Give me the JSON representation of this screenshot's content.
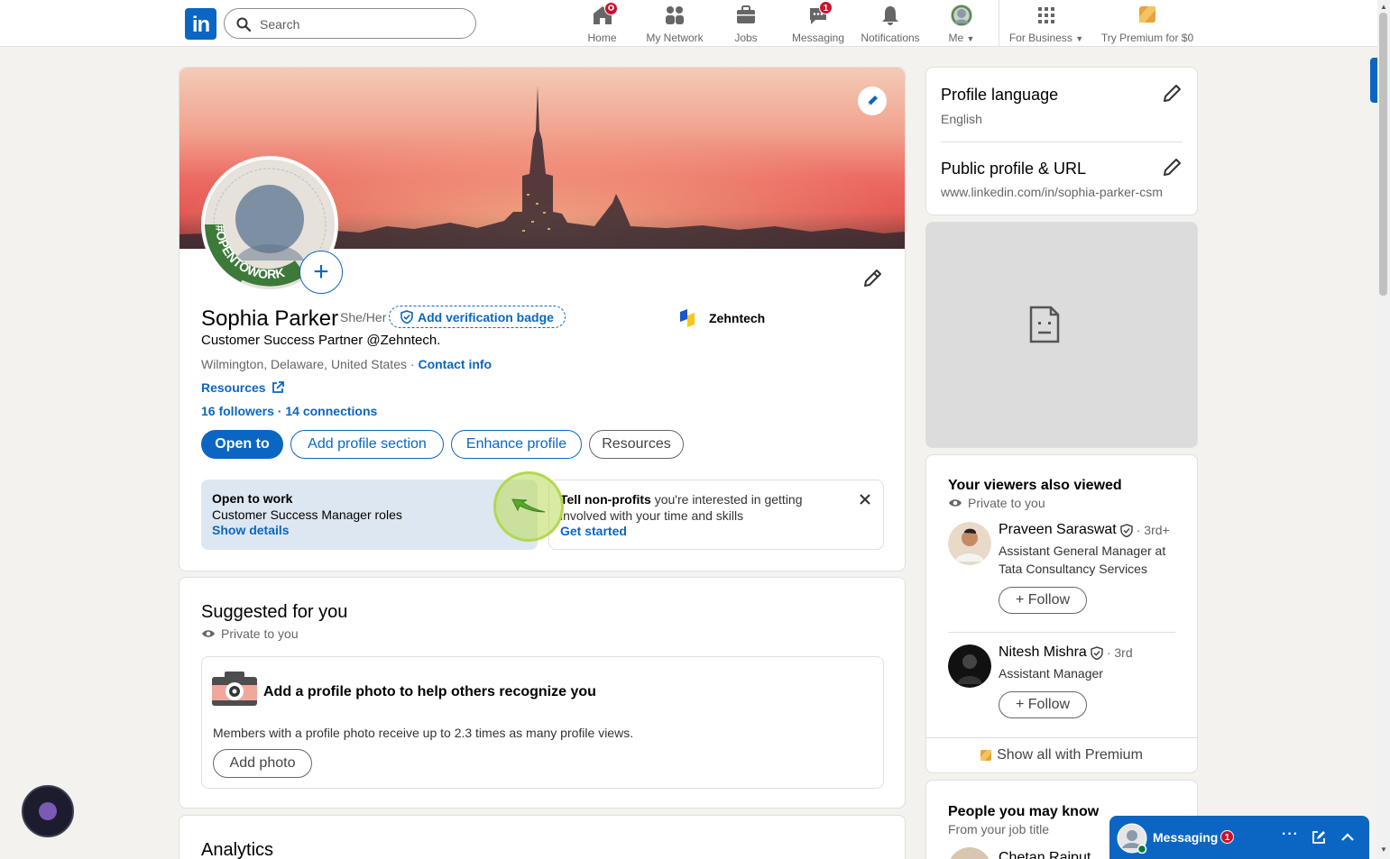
{
  "nav": {
    "logo": "in",
    "search_placeholder": "Search",
    "items": [
      {
        "label": "Home",
        "icon": "home-icon",
        "badge": ""
      },
      {
        "label": "My Network",
        "icon": "network-icon",
        "badge": ""
      },
      {
        "label": "Jobs",
        "icon": "briefcase-icon",
        "badge": ""
      },
      {
        "label": "Messaging",
        "icon": "chat-icon",
        "badge": "1"
      },
      {
        "label": "Notifications",
        "icon": "bell-icon",
        "badge": ""
      },
      {
        "label": "Me",
        "icon": "avatar-icon",
        "badge": ""
      }
    ],
    "business": "For Business",
    "premium": "Try Premium for $0"
  },
  "profile": {
    "name": "Sophia Parker",
    "pronouns": "She/Her",
    "verify": "Add verification badge",
    "headline": "Customer Success Partner @Zehntech.",
    "location": "Wilmington, Delaware, United States",
    "location_sep": " · ",
    "contact": "Contact info",
    "resources_link": "Resources",
    "followers": "16 followers",
    "connections": "14 connections",
    "stats_sep": " · ",
    "company": "Zehntech",
    "otw_ring": "#OPENTOWORK",
    "buttons": {
      "open_to": "Open to",
      "add_section": "Add profile section",
      "enhance": "Enhance profile",
      "resources": "Resources"
    },
    "open_to_work": {
      "title": "Open to work",
      "roles": "Customer Success Manager roles",
      "link": "Show details"
    },
    "nonprofit": {
      "bold": "Tell non-profits",
      "text": " you're interested in getting involved with your time and skills",
      "link": "Get started"
    }
  },
  "suggested": {
    "title": "Suggested for you",
    "private": "Private to you",
    "card_title": "Add a profile photo to help others recognize you",
    "card_text": "Members with a profile photo receive up to 2.3 times as many profile views.",
    "button": "Add photo"
  },
  "analytics": {
    "title": "Analytics"
  },
  "sidebar": {
    "language_title": "Profile language",
    "language_value": "English",
    "url_title": "Public profile & URL",
    "url_value": "www.linkedin.com/in/sophia-parker-csm",
    "viewers_title": "Your viewers also viewed",
    "viewers_private": "Private to you",
    "people": [
      {
        "name": "Praveen Saraswat",
        "degree": "· 3rd+",
        "title": "Assistant General Manager at Tata Consultancy Services",
        "follow": "Follow"
      },
      {
        "name": "Nitesh Mishra",
        "degree": "· 3rd",
        "title": "Assistant Manager",
        "follow": "Follow"
      }
    ],
    "show_all": "Show all with Premium",
    "pymk_title": "People you may know",
    "pymk_sub": "From your job title",
    "pymk_peek": "Chetan Rajput"
  },
  "messaging": {
    "label": "Messaging",
    "badge": "1"
  },
  "colors": {
    "brand": "#0a66c2",
    "badge": "#cb112d",
    "otw_green": "#3d7a3a",
    "premium": "#e7a33e"
  }
}
